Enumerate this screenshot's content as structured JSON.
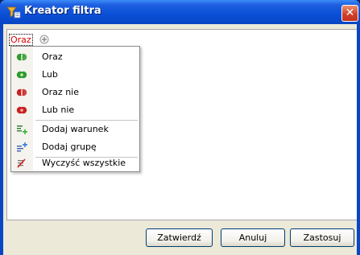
{
  "window": {
    "title": "Kreator filtra",
    "close_label": "✕"
  },
  "editor": {
    "root_operator": "Oraz"
  },
  "menu": {
    "items": [
      {
        "label": "Oraz",
        "icon": "and-icon"
      },
      {
        "label": "Lub",
        "icon": "or-icon"
      },
      {
        "label": "Oraz nie",
        "icon": "and-not-icon"
      },
      {
        "label": "Lub nie",
        "icon": "or-not-icon"
      },
      {
        "label": "Dodaj warunek",
        "icon": "add-condition-icon"
      },
      {
        "label": "Dodaj grupę",
        "icon": "add-group-icon"
      },
      {
        "label": "Wyczyść wszystkie",
        "icon": "clear-all-icon"
      }
    ]
  },
  "buttons": {
    "ok": "Zatwierdź",
    "cancel": "Anuluj",
    "apply": "Zastosuj"
  },
  "colors": {
    "title_bar": "#0a4fd6",
    "operator_text": "#d40000",
    "client_bg": "#ece9d8"
  }
}
